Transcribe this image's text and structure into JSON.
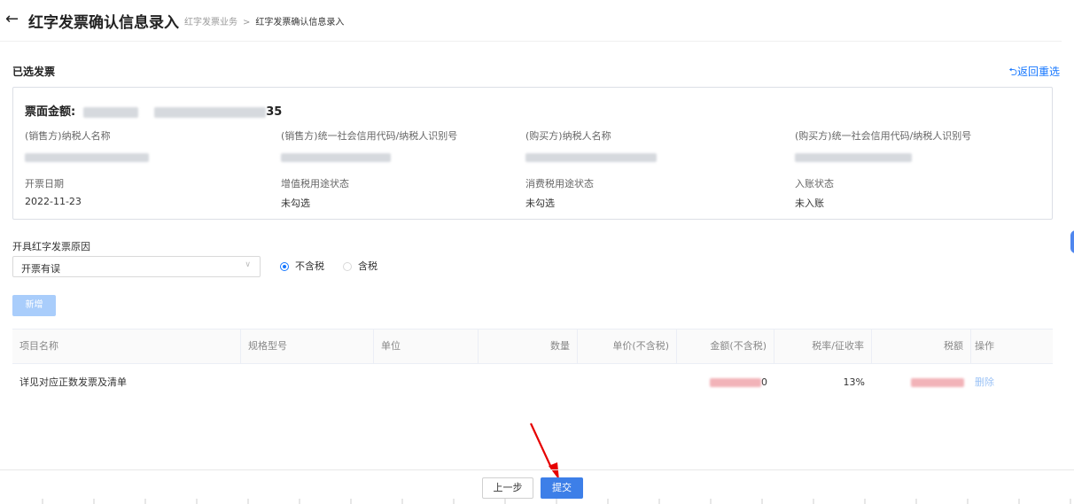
{
  "header": {
    "title": "红字发票确认信息录入",
    "breadcrumb": [
      "红字发票业务",
      "红字发票确认信息录入"
    ],
    "breadcrumb_sep": ">"
  },
  "selected": {
    "title": "已选发票",
    "reselect": "返回重选",
    "amount_label": "票面金额:",
    "invoice_label_suffix": "35",
    "fields": [
      {
        "label": "(销售方)纳税人名称",
        "value": ""
      },
      {
        "label": "(销售方)统一社会信用代码/纳税人识别号",
        "value": ""
      },
      {
        "label": "(购买方)纳税人名称",
        "value": ""
      },
      {
        "label": "(购买方)统一社会信用代码/纳税人识别号",
        "value": ""
      },
      {
        "label": "开票日期",
        "value": "2022-11-23"
      },
      {
        "label": "增值税用途状态",
        "value": "未勾选"
      },
      {
        "label": "消费税用途状态",
        "value": "未勾选"
      },
      {
        "label": "入账状态",
        "value": "未入账"
      }
    ]
  },
  "reason": {
    "label": "开具红字发票原因",
    "value": "开票有误",
    "options": [
      "不含税",
      "含税"
    ],
    "selected": "不含税"
  },
  "add_button": "新增",
  "table": {
    "headers": [
      "项目名称",
      "规格型号",
      "单位",
      "数量",
      "单价(不含税)",
      "金额(不含税)",
      "税率/征收率",
      "税额",
      "操作"
    ],
    "rows": [
      {
        "name": "详见对应正数发票及清单",
        "spec": "",
        "unit": "",
        "qty": "",
        "price": "",
        "amount_tail": "0",
        "rate": "13%",
        "tax": "",
        "action": "删除"
      }
    ]
  },
  "footer": {
    "prev": "上一步",
    "submit": "提交"
  },
  "colors": {
    "primary": "#3d7fe8",
    "link": "#1677ff",
    "disabled": "#a9cdfb",
    "annotation_arrow": "#e60000"
  },
  "icons": [
    "back-arrow-icon",
    "undo-icon",
    "chevron-down-icon"
  ]
}
